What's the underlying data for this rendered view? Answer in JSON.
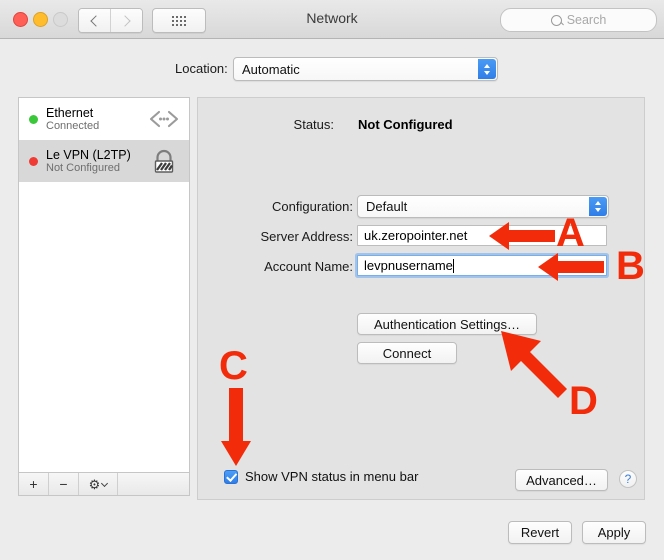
{
  "window": {
    "title": "Network",
    "traffic_lights": [
      "close",
      "minimize",
      "zoom"
    ],
    "nav": {
      "back_icon": "chevron-left-icon",
      "forward_icon": "chevron-right-icon"
    },
    "show_all_icon": "grid-icon",
    "search": {
      "placeholder": "Search",
      "value": "",
      "icon": "search-icon"
    }
  },
  "location": {
    "label": "Location:",
    "value": "Automatic"
  },
  "sidebar": {
    "services": [
      {
        "name": "Ethernet",
        "status": "Connected",
        "led_color": "#3ac73a",
        "icon": "ethernet-icon",
        "selected": false
      },
      {
        "name": "Le VPN (L2TP)",
        "status": "Not Configured",
        "led_color": "#f03b35",
        "icon": "lock-icon",
        "selected": true
      }
    ],
    "toolbar": {
      "add_label": "+",
      "remove_label": "−",
      "action_icon": "gear-icon"
    }
  },
  "panel": {
    "status_label": "Status:",
    "status_value": "Not Configured",
    "configuration_label": "Configuration:",
    "configuration_value": "Default",
    "server_address_label": "Server Address:",
    "server_address_value": "uk.zeropointer.net",
    "account_name_label": "Account Name:",
    "account_name_value": "levpnusername",
    "auth_settings_label": "Authentication Settings…",
    "connect_label": "Connect",
    "show_vpn_status_label": "Show VPN status in menu bar",
    "show_vpn_status_checked": true,
    "advanced_label": "Advanced…",
    "help_label": "?"
  },
  "footer": {
    "revert_label": "Revert",
    "apply_label": "Apply"
  },
  "annotations": {
    "accent_color": "#f22c0a",
    "items": [
      {
        "letter": "A",
        "points_at": "server-address-field",
        "direction": "left"
      },
      {
        "letter": "B",
        "points_at": "account-name-field",
        "direction": "left"
      },
      {
        "letter": "C",
        "points_at": "show-vpn-status-checkbox",
        "direction": "down"
      },
      {
        "letter": "D",
        "points_at": "authentication-settings-button",
        "direction": "up-left"
      }
    ]
  }
}
